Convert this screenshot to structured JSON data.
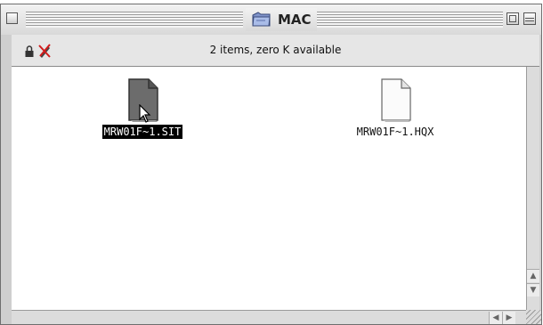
{
  "window": {
    "title": "MAC",
    "status": "2 items, zero K available"
  },
  "files": [
    {
      "name": "MRW01F~1.SIT",
      "selected": true,
      "icon": "document-icon-dark"
    },
    {
      "name": "MRW01F~1.HQX",
      "selected": false,
      "icon": "document-icon-light"
    }
  ],
  "icons": {
    "title": "folder-icon",
    "header": [
      "lock-icon",
      "pencil-crossed-icon"
    ],
    "cursor": "arrow-cursor-icon"
  },
  "scroll": {
    "up": "▲",
    "down": "▼",
    "left": "◀",
    "right": "▶"
  },
  "colors": {
    "selection": "#000000",
    "folder": "#8fa6d9"
  }
}
